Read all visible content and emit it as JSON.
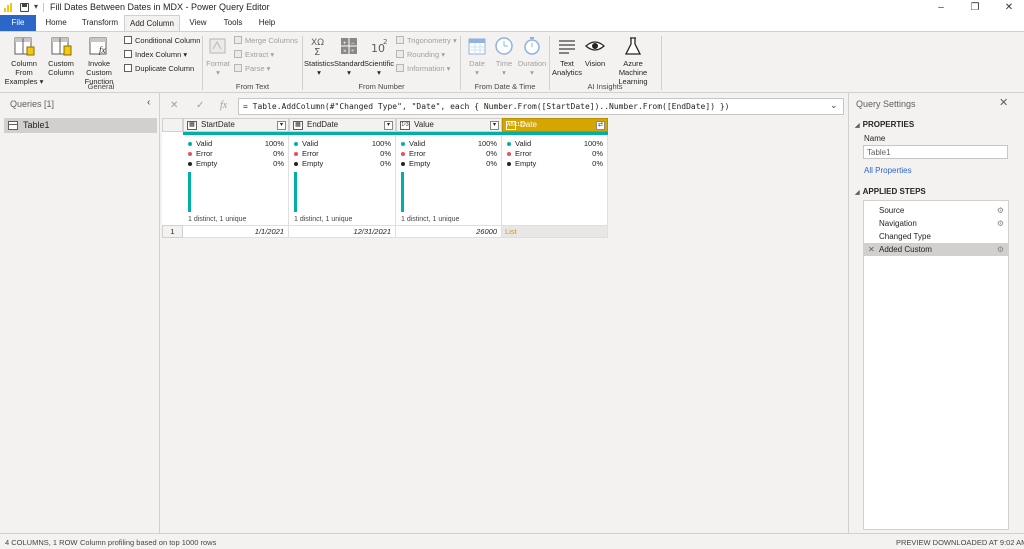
{
  "window": {
    "title": "Fill Dates Between Dates in MDX - Power Query Editor",
    "qa_dropdown": "▾",
    "minimize": "–",
    "maximize": "❐",
    "close": "✕"
  },
  "tabs": [
    "File",
    "Home",
    "Transform",
    "Add Column",
    "View",
    "Tools",
    "Help"
  ],
  "active_tab": "Add Column",
  "ribbon": {
    "general": {
      "label": "General",
      "column_from_examples": [
        "Column From",
        "Examples ▾"
      ],
      "custom_column": [
        "Custom",
        "Column"
      ],
      "invoke_custom_function": [
        "Invoke Custom",
        "Function"
      ],
      "conditional_column": "Conditional Column",
      "index_column": "Index Column ▾",
      "duplicate_column": "Duplicate Column"
    },
    "from_text": {
      "label": "From Text",
      "format": [
        "Format",
        "▾"
      ],
      "merge_columns": "Merge Columns",
      "extract": "Extract ▾",
      "parse": "Parse ▾"
    },
    "from_number": {
      "label": "From Number",
      "statistics": [
        "Statistics",
        "▾"
      ],
      "standard": [
        "Standard",
        "▾"
      ],
      "scientific": [
        "Scientific",
        "▾"
      ],
      "trigonometry": "Trigonometry ▾",
      "rounding": "Rounding ▾",
      "information": "Information ▾"
    },
    "from_date_time": {
      "label": "From Date & Time",
      "date": [
        "Date",
        "▾"
      ],
      "time": [
        "Time",
        "▾"
      ],
      "duration": [
        "Duration",
        "▾"
      ]
    },
    "ai_insights": {
      "label": "AI Insights",
      "text_analytics": [
        "Text",
        "Analytics"
      ],
      "vision": [
        "Vision"
      ],
      "azure_ml": [
        "Azure Machine",
        "Learning"
      ]
    }
  },
  "queries": {
    "title": "Queries [1]",
    "collapse": "‹",
    "items": [
      "Table1"
    ]
  },
  "formula_bar": {
    "cancel": "✕",
    "commit": "✓",
    "fx": "fx",
    "formula": "= Table.AddColumn(#\"Changed Type\", \"Date\", each { Number.From([StartDate])..Number.From([EndDate]) })",
    "expand": "⌄"
  },
  "grid": {
    "columns": [
      {
        "name": "StartDate",
        "type_icon": "▦",
        "valid": "100%",
        "error": "0%",
        "empty": "0%",
        "distinct": "1 distinct, 1 unique",
        "value": "1/1/2021"
      },
      {
        "name": "EndDate",
        "type_icon": "▦",
        "valid": "100%",
        "error": "0%",
        "empty": "0%",
        "distinct": "1 distinct, 1 unique",
        "value": "12/31/2021"
      },
      {
        "name": "Value",
        "type_icon": "1²3",
        "valid": "100%",
        "error": "0%",
        "empty": "0%",
        "distinct": "1 distinct, 1 unique",
        "value": "26000"
      },
      {
        "name": "Date",
        "type_icon": "ABC123",
        "valid": "100%",
        "error": "0%",
        "empty": "0%",
        "distinct": "",
        "value": "List"
      }
    ],
    "stat_labels": {
      "valid": "Valid",
      "error": "Error",
      "empty": "Empty"
    },
    "row_number": "1",
    "dropdown": "▾",
    "expand_icon": "⇄"
  },
  "colors": {
    "valid": "#00b0a8",
    "error": "#e8505b",
    "empty": "#252423",
    "selected_column": "#d6a600",
    "file_tab": "#2b66c9"
  },
  "settings": {
    "title": "Query Settings",
    "close": "✕",
    "properties_heading": "PROPERTIES",
    "name_label": "Name",
    "name_value": "Table1",
    "all_properties": "All Properties",
    "steps_heading": "APPLIED STEPS",
    "steps": [
      {
        "label": "Source",
        "gear": "⚙"
      },
      {
        "label": "Navigation",
        "gear": "⚙"
      },
      {
        "label": "Changed Type",
        "gear": ""
      },
      {
        "label": "Added Custom",
        "gear": "⚙"
      }
    ],
    "active_step_delete": "✕"
  },
  "status": {
    "columns_rows": "4 COLUMNS, 1 ROW",
    "profiling": "Column profiling based on top 1000 rows",
    "preview": "PREVIEW DOWNLOADED AT 9:02 AM"
  }
}
